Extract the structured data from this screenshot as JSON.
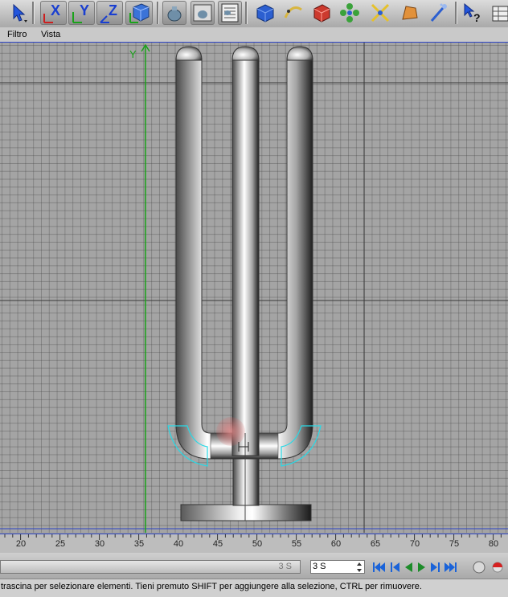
{
  "toolbar": {
    "axis_x": "X",
    "axis_y": "Y",
    "axis_z": "Z"
  },
  "menu": {
    "items": [
      "Filtro",
      "Vista"
    ]
  },
  "viewport": {
    "axis_label": "Y"
  },
  "ruler": {
    "ticks": [
      "20",
      "25",
      "30",
      "35",
      "40",
      "45",
      "50",
      "55",
      "60",
      "65",
      "70",
      "75",
      "80"
    ]
  },
  "timeline": {
    "left_field": "3 S",
    "current_frame": "3 S"
  },
  "status": {
    "text": "trascina per selezionare elementi. Tieni premuto SHIFT per aggiungere alla selezione, CTRL per rimuovere."
  },
  "colors": {
    "y_axis": "#1aa21a",
    "selection_arcs": "#27d9e6",
    "blue_guide": "#2d44c5",
    "playback": "#1a63d9"
  }
}
